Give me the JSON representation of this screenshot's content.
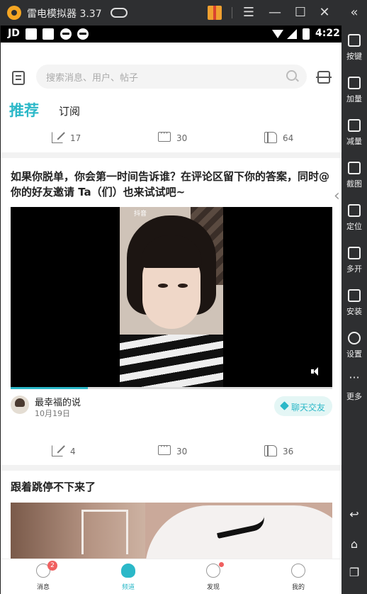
{
  "emulator": {
    "title": "雷电模拟器 3.37",
    "sidebar": [
      {
        "label": "按键",
        "icon": "keyboard-icon"
      },
      {
        "label": "加量",
        "icon": "volume-up-icon"
      },
      {
        "label": "减量",
        "icon": "volume-down-icon"
      },
      {
        "label": "截图",
        "icon": "scissors-icon"
      },
      {
        "label": "定位",
        "icon": "location-pin-icon"
      },
      {
        "label": "多开",
        "icon": "multi-instance-icon"
      },
      {
        "label": "安装",
        "icon": "apk-install-icon"
      },
      {
        "label": "设置",
        "icon": "gear-icon"
      },
      {
        "label": "更多",
        "icon": "more-dots-icon"
      }
    ],
    "window_controls": {
      "menu": "☰",
      "minimize": "—",
      "maximize": "☐",
      "close": "✕",
      "collapse": "«"
    },
    "nav_buttons": {
      "back": "↩",
      "home": "⌂",
      "recents": "❐"
    }
  },
  "statusbar": {
    "carrier": "JD",
    "time": "4:22"
  },
  "search": {
    "placeholder": "搜索消息、用户、帖子"
  },
  "tabs": {
    "recommend": "推荐",
    "subscribe": "订阅"
  },
  "post1": {
    "share_count": "17",
    "comment_count": "30",
    "like_count": "64"
  },
  "post2": {
    "title": "如果你脱单，你会第一时间告诉谁？在评论区留下你的答案，同时@你的好友邀请 Ta（们）也来试试吧~",
    "video_brand": "抖音",
    "video_progress": 0.24,
    "author": "最幸福的说",
    "date": "10月19日",
    "chat_button": "聊天交友",
    "share_count": "4",
    "comment_count": "30",
    "like_count": "36"
  },
  "post3": {
    "title": "跟着跳停不下来了"
  },
  "bottom_nav": {
    "messages": "消息",
    "messages_badge": "2",
    "channels": "频道",
    "discover": "发现",
    "mine": "我的"
  },
  "colors": {
    "accent": "#2bb8c8",
    "badge": "#f06060"
  }
}
